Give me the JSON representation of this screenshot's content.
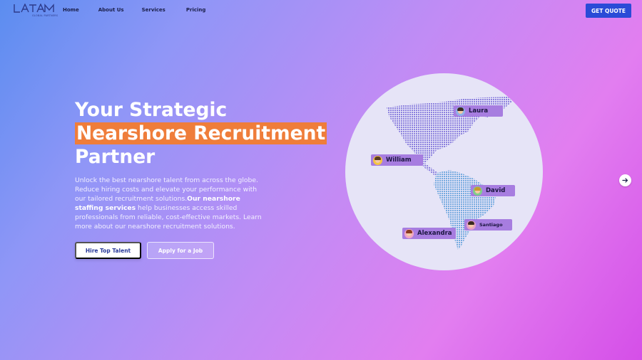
{
  "brand": {
    "logo_text": "LATAM",
    "logo_subtext": "GLOBAL PARTNERS"
  },
  "nav": {
    "items": [
      {
        "label": "Home"
      },
      {
        "label": "About Us"
      },
      {
        "label": "Services"
      },
      {
        "label": "Pricing"
      }
    ],
    "cta_label": "GET QUOTE"
  },
  "hero": {
    "title_line1": "Your Strategic",
    "title_highlight": "Nearshore Recruitment",
    "title_line3": "Partner",
    "subtitle_part1": "Unlock the best nearshore talent from across the globe. Reduce hiring costs and elevate your performance with our tailored recruitment solutions.",
    "subtitle_bold": "Our nearshore staffing services",
    "subtitle_part2": " help businesses access skilled professionals from reliable, cost-effective markets. Learn more about our nearshore recruitment solutions.",
    "primary_button": "Hire Top Talent",
    "secondary_button": "Apply for a Job"
  },
  "map": {
    "people": [
      {
        "name": "Laura"
      },
      {
        "name": "William"
      },
      {
        "name": "David"
      },
      {
        "name": "Santiago"
      },
      {
        "name": "Alexandra"
      }
    ]
  },
  "colors": {
    "accent": "#ef7d3a",
    "cta": "#2a4bd7",
    "label_bg": "#a77de0",
    "map_bg": "#e6e4f7"
  },
  "icons": {
    "next": "arrow-right-icon"
  }
}
